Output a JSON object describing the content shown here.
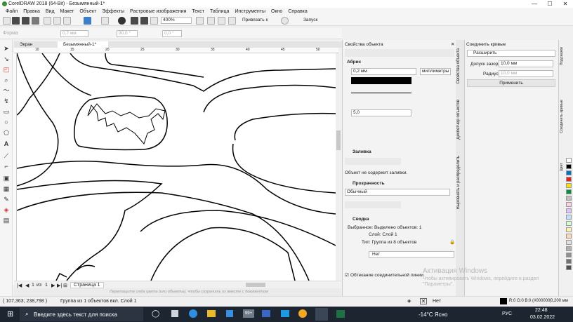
{
  "window": {
    "title": "CorelDRAW 2018 (64-Bit) - Безымянный-1*",
    "min": "—",
    "max": "☐",
    "close": "✕"
  },
  "menu": [
    "Файл",
    "Правка",
    "Вид",
    "Макет",
    "Объект",
    "Эффекты",
    "Растровые изображения",
    "Текст",
    "Таблица",
    "Инструменты",
    "Окно",
    "Справка"
  ],
  "toolbar": {
    "zoom": "400%",
    "snap": "Привязать к",
    "launch": "Запуск"
  },
  "propbar": {
    "label": "Форма",
    "width": "0,7 мм",
    "angle": "90,0 °",
    "angle2": "0,0 °"
  },
  "doctabs": [
    "Экран приветствия",
    "Безымянный-1*"
  ],
  "rulers": {
    "top": [
      "10",
      "15",
      "20",
      "25",
      "30",
      "35",
      "40",
      "45",
      "50"
    ]
  },
  "pages": {
    "current": "1",
    "of": "из",
    "total": "1",
    "tab": "Страница 1"
  },
  "hint": "Перетащите сюда цвета (или объекты), чтобы сохранить их вместе с документом",
  "props": {
    "title": "Свойства объекта",
    "outline": "Абрис",
    "outline_width": "0,2 мм",
    "units": "миллиметры",
    "miter": "5,0",
    "fill": "Заливка",
    "fill_none": "Объект не содержит заливки.",
    "transparency": "Прозрачность",
    "transparency_mode": "Обычный",
    "summary": "Сводка",
    "selected": "Выбранное: Выделено объектов: 1",
    "layer": "Слой: Слой 1",
    "type": "Тип: Группа из 8 объектов",
    "net": "Нет",
    "wrap": "Обтекание соединительной линии"
  },
  "vtabs": [
    "Свойства объекта",
    "Диспетчер объектов",
    "Выровнять и распределить"
  ],
  "join": {
    "title": "Соединить кривые",
    "mode": "Расширить",
    "tol_label": "Допуск зазора:",
    "tol": "10,0 мм",
    "rad_label": "Радиус:",
    "rad": "10,0 мм",
    "apply": "Применить"
  },
  "dock2": [
    "Подсказки",
    "Соединить кривые",
    "Цвет"
  ],
  "palette": [
    "#ffffff",
    "#000000",
    "#0074c8",
    "#e42320",
    "#f9e000",
    "#00923f",
    "#c0c0c0",
    "#ffd0e0",
    "#e0c0ff",
    "#c0e0ff",
    "#d0ffd0",
    "#fff0b0",
    "#ffd8b0",
    "#e0e0e0",
    "#b0b0b0",
    "#909090",
    "#707070",
    "#505050"
  ],
  "status": {
    "coords": "( 107,363; 238,798 )",
    "sel": "Группа из 1 объектов вкл. Слой 1",
    "fill": "Нет",
    "outline": "R:0 G:0 B:0 (#000000)",
    "width": "0,200 мм"
  },
  "watermark": {
    "line1": "Активация Windows",
    "line2": "Чтобы активировать Windows, перейдите в раздел",
    "line3": "\"Параметры\"."
  },
  "taskbar": {
    "search": "Введите здесь текст для поиска",
    "badge": "99+",
    "temp": "-14°C Ясно",
    "lang": "РУС",
    "time": "22:48",
    "date": "03.02.2022"
  }
}
